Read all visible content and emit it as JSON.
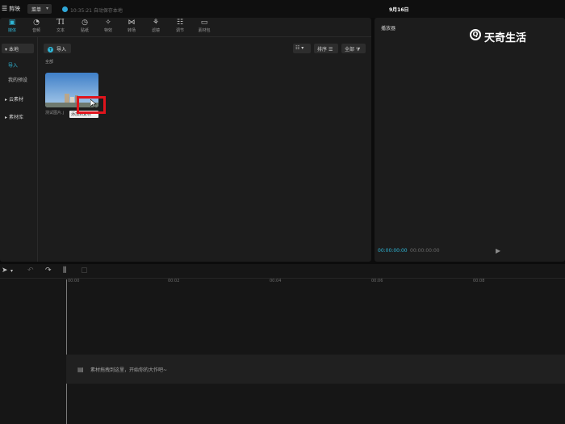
{
  "titlebar": {
    "app_name": "剪映",
    "menu_label": "菜单",
    "autosave_text": "10:35:21 自动保存本地",
    "date_text": "9月16日"
  },
  "toolbar": {
    "tools": [
      {
        "label": "媒体",
        "icon": "media-icon",
        "active": true
      },
      {
        "label": "音频",
        "icon": "audio-icon"
      },
      {
        "label": "文本",
        "icon": "text-icon"
      },
      {
        "label": "贴纸",
        "icon": "sticker-icon"
      },
      {
        "label": "特效",
        "icon": "effects-icon"
      },
      {
        "label": "转场",
        "icon": "transition-icon"
      },
      {
        "label": "滤镜",
        "icon": "filter-icon"
      },
      {
        "label": "调节",
        "icon": "adjust-icon"
      },
      {
        "label": "素材包",
        "icon": "package-icon"
      }
    ]
  },
  "sidebar": {
    "local": "本地",
    "import": "导入",
    "my_presets": "我的预设",
    "cloud": "云素材",
    "library": "素材库"
  },
  "media": {
    "import_button": "导入",
    "sort_label": "排序",
    "all_label": "全部",
    "section_label": "全部",
    "item_caption": "测试图片.j",
    "tooltip": "添加到素材"
  },
  "player": {
    "title": "播放器",
    "time_current": "00:00:00:00",
    "time_total": "00:00:00:00"
  },
  "watermark": {
    "text": "天奇生活"
  },
  "timeline": {
    "ticks": [
      "00:00",
      "00:02",
      "00:04",
      "00:06",
      "00:08"
    ],
    "drop_hint": "素材拖拽到这里，开始你的大作吧~"
  },
  "colors": {
    "accent": "#2fb6d6",
    "highlight": "#e0141c"
  }
}
